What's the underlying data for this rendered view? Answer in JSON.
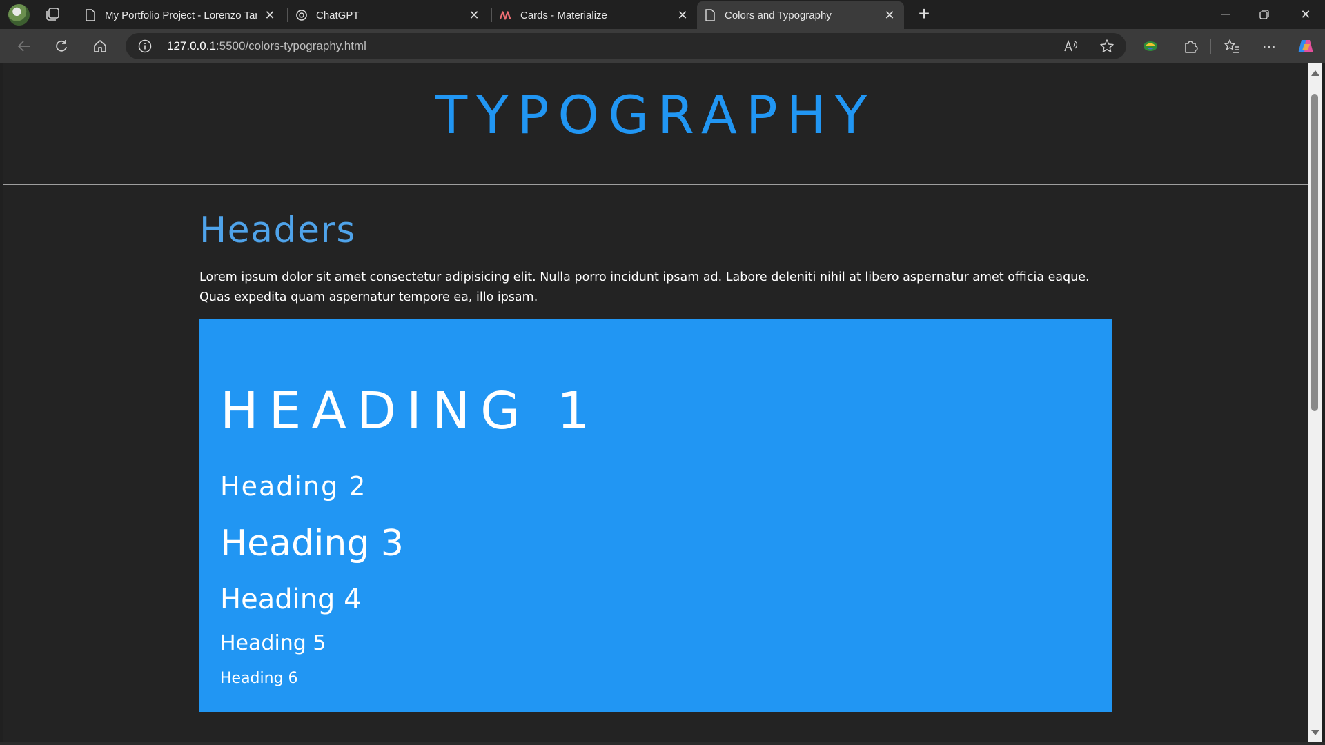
{
  "browser": {
    "tabs": [
      {
        "title": "My Portfolio Project - Lorenzo Tar",
        "favicon": "page-icon",
        "active": false
      },
      {
        "title": "ChatGPT",
        "favicon": "chatgpt-icon",
        "active": false
      },
      {
        "title": "Cards - Materialize",
        "favicon": "materialize-icon",
        "active": false
      },
      {
        "title": "Colors and Typography",
        "favicon": "page-icon",
        "active": true
      }
    ],
    "url_host": "127.0.0.1",
    "url_path": ":5500/colors-typography.html"
  },
  "page": {
    "title": "TYPOGRAPHY",
    "section_title": "Headers",
    "lorem": "Lorem ipsum dolor sit amet consectetur adipisicing elit. Nulla porro incidunt ipsam ad. Labore deleniti nihil at libero aspernatur amet officia eaque. Quas expedita quam aspernatur tempore ea, illo ipsam.",
    "headings": {
      "h1": "HEADING 1",
      "h2": "Heading 2",
      "h3": "Heading 3",
      "h4": "Heading 4",
      "h5": "Heading 5",
      "h6": "Heading 6"
    }
  },
  "colors": {
    "accent_blue": "#2196f3",
    "page_background": "#232323",
    "chrome_background": "#202020",
    "toolbar_background": "#3b3b3b"
  }
}
